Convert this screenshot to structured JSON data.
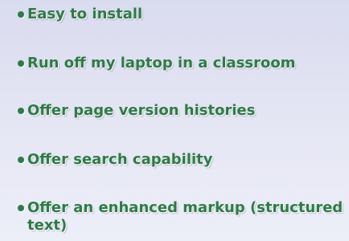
{
  "bullets": [
    {
      "text": "Easy to install"
    },
    {
      "text": "Run off my laptop in a classroom"
    },
    {
      "text": "Offer page version histories"
    },
    {
      "text": "Offer search capability"
    },
    {
      "text": "Offer an enhanced markup (structured text)"
    }
  ],
  "colors": {
    "text": "#2f7a49",
    "background": "#e6e7f4"
  }
}
